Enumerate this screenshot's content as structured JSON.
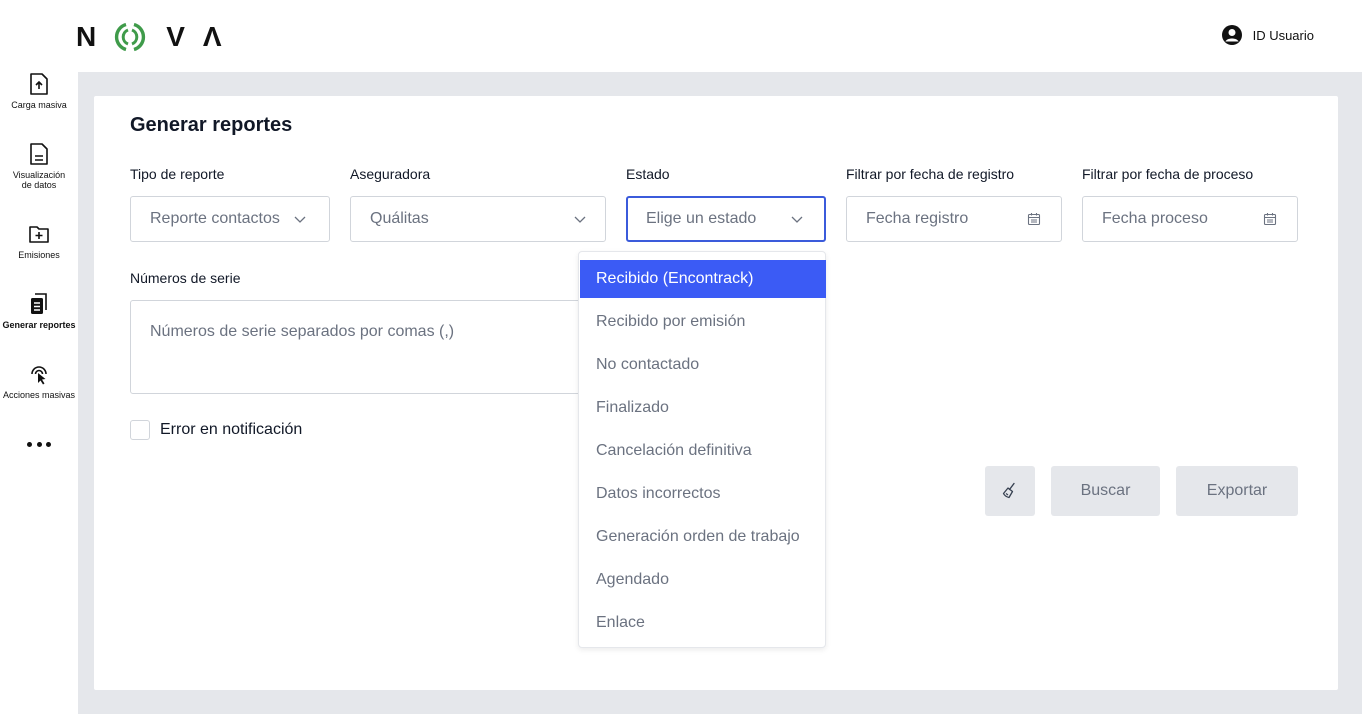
{
  "header": {
    "logo_text": "NOVA",
    "user_label": "ID Usuario"
  },
  "sidebar": {
    "items": [
      {
        "label": "Carga masiva",
        "icon": "upload-file-icon"
      },
      {
        "label": "Visualización de datos",
        "icon": "document-icon"
      },
      {
        "label": "Emisiones",
        "icon": "folder-plus-icon"
      },
      {
        "label": "Generar reportes",
        "icon": "reports-icon",
        "active": true
      },
      {
        "label": "Acciones masivas",
        "icon": "touch-icon"
      }
    ],
    "more_icon": "more-dots-icon"
  },
  "main": {
    "title": "Generar reportes",
    "fields": {
      "tipo_reporte": {
        "label": "Tipo de reporte",
        "value": "Reporte contactos"
      },
      "aseguradora": {
        "label": "Aseguradora",
        "value": "Quálitas"
      },
      "estado": {
        "label": "Estado",
        "placeholder": "Elige un estado"
      },
      "fecha_registro": {
        "label": "Filtrar por fecha de registro",
        "placeholder": "Fecha registro"
      },
      "fecha_proceso": {
        "label": "Filtrar por fecha de proceso",
        "placeholder": "Fecha proceso"
      }
    },
    "series": {
      "label": "Números de serie",
      "placeholder": "Números de serie separados por comas (,)"
    },
    "checkbox": {
      "label": "Error en notificación",
      "checked": false
    },
    "buttons": {
      "clear_icon": "broom-icon",
      "search": "Buscar",
      "export": "Exportar"
    }
  },
  "estado_dropdown": {
    "selected_index": 0,
    "options": [
      "Recibido (Encontrack)",
      "Recibido por emisión",
      "No contactado",
      "Finalizado",
      "Cancelación definitiva",
      "Datos incorrectos",
      "Generación orden de trabajo",
      "Agendado",
      "Enlace"
    ]
  },
  "colors": {
    "accent": "#3b5bf5",
    "logo_green": "#3f9b4a",
    "background": "#e5e7eb"
  }
}
